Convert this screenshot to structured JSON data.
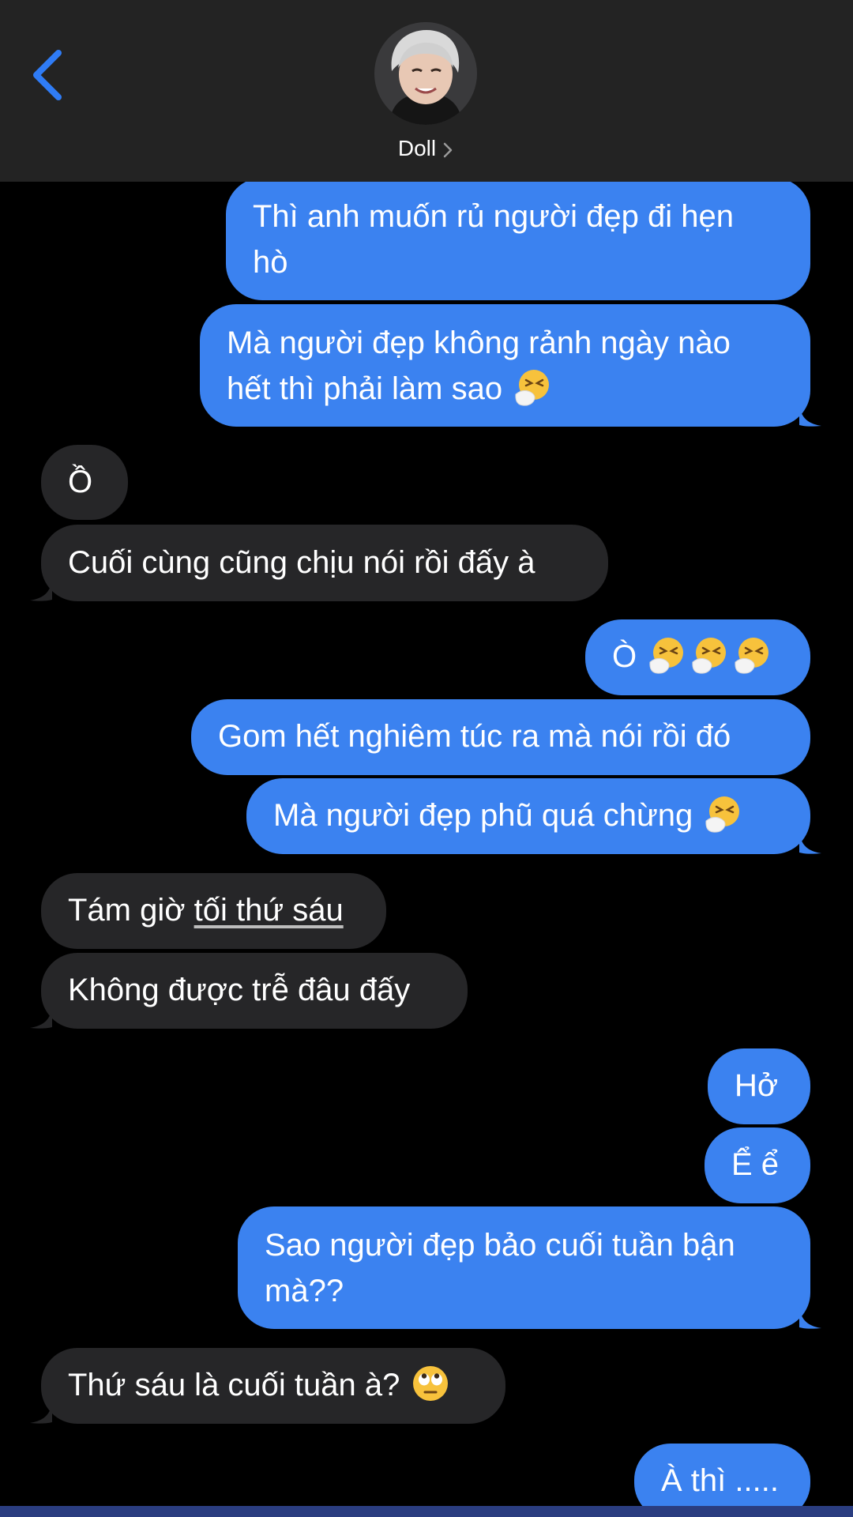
{
  "header": {
    "contact_name": "Doll",
    "back_icon": "chevron-left-icon",
    "name_chevron_icon": "chevron-right-icon"
  },
  "colors": {
    "outgoing": "#3b82f0",
    "incoming": "#262628",
    "header_bg": "#232323",
    "accent": "#2f7cf6"
  },
  "messages": [
    {
      "dir": "out",
      "text": "Thì anh muốn rủ người đẹp đi hẹn",
      "text2": "hò"
    },
    {
      "dir": "out",
      "text": "Mà người đẹp không rảnh ngày nào",
      "text2": "hết thì phải làm sao",
      "emoji": "sneezing-face"
    },
    {
      "dir": "in",
      "text": "Ồ"
    },
    {
      "dir": "in",
      "text": "Cuối cùng cũng chịu nói rồi đấy à"
    },
    {
      "dir": "out",
      "text": "Ò",
      "emoji": "sneezing-face ×3"
    },
    {
      "dir": "out",
      "text": "Gom hết nghiêm túc ra mà nói rồi đó"
    },
    {
      "dir": "out",
      "text": "Mà người đẹp phũ quá chừng",
      "emoji": "sneezing-face"
    },
    {
      "dir": "in",
      "text": "Tám giờ ",
      "text_underlined": "tối thứ sáu"
    },
    {
      "dir": "in",
      "text": "Không được trễ đâu đấy"
    },
    {
      "dir": "out",
      "text": "Hở"
    },
    {
      "dir": "out",
      "text": "Ể ể"
    },
    {
      "dir": "out",
      "text": "Sao người đẹp bảo cuối tuần bận",
      "text2": "mà??"
    },
    {
      "dir": "in",
      "text": "Thứ sáu là cuối tuần à?",
      "emoji": "face-with-rolling-eyes"
    },
    {
      "dir": "out",
      "text": "À thì ....."
    }
  ]
}
